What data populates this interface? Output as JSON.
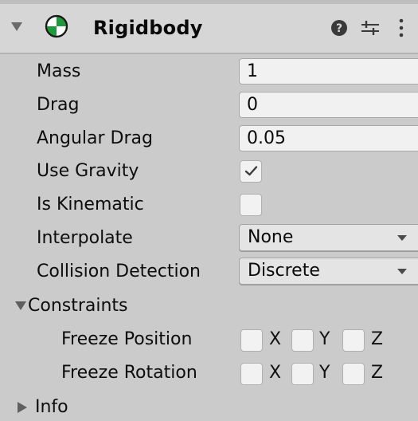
{
  "component": {
    "title": "Rigidbody",
    "icon": "rigidbody-icon",
    "header_icons": [
      "help-icon",
      "preset-icon",
      "menu-icon"
    ]
  },
  "fields": {
    "mass": {
      "label": "Mass",
      "value": "1"
    },
    "drag": {
      "label": "Drag",
      "value": "0"
    },
    "angular_drag": {
      "label": "Angular Drag",
      "value": "0.05"
    },
    "use_gravity": {
      "label": "Use Gravity",
      "checked": true
    },
    "is_kinematic": {
      "label": "Is Kinematic",
      "checked": false
    },
    "interpolate": {
      "label": "Interpolate",
      "value": "None"
    },
    "collision_detection": {
      "label": "Collision Detection",
      "value": "Discrete"
    }
  },
  "constraints": {
    "label": "Constraints",
    "expanded": true,
    "freeze_position": {
      "label": "Freeze Position",
      "axes": [
        {
          "label": "X",
          "checked": false
        },
        {
          "label": "Y",
          "checked": false
        },
        {
          "label": "Z",
          "checked": false
        }
      ]
    },
    "freeze_rotation": {
      "label": "Freeze Rotation",
      "axes": [
        {
          "label": "X",
          "checked": false
        },
        {
          "label": "Y",
          "checked": false
        },
        {
          "label": "Z",
          "checked": false
        }
      ]
    }
  },
  "info": {
    "label": "Info",
    "expanded": false
  },
  "colors": {
    "background": "#cbcbcb",
    "header": "#d6d6d6",
    "field": "#f1f1f1",
    "icon_green": "#1f9a3a"
  }
}
